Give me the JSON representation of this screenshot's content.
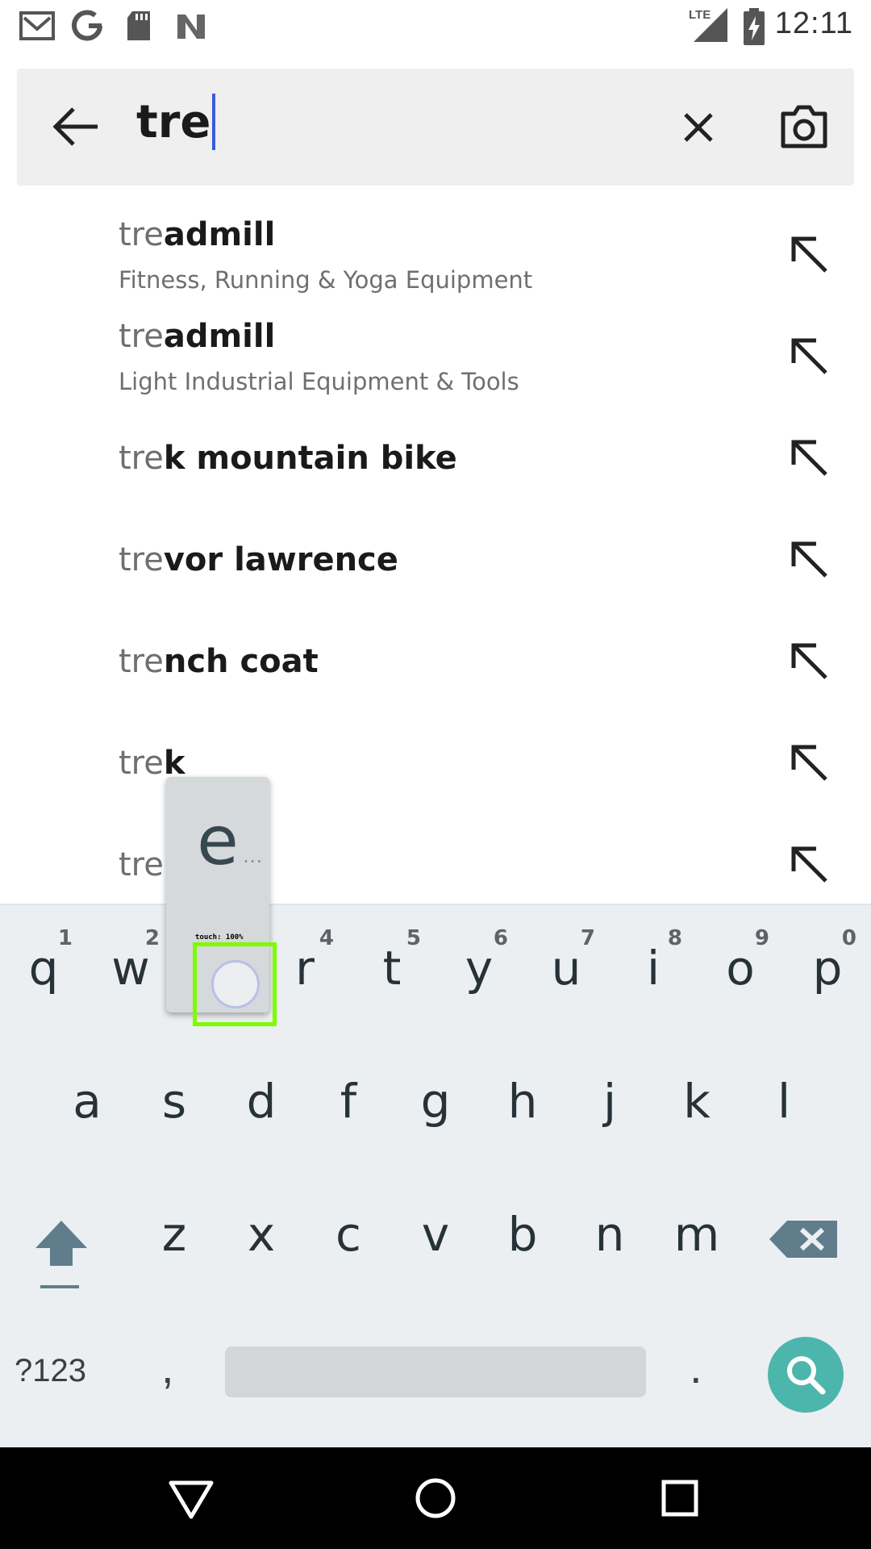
{
  "status_bar": {
    "time": "12:11",
    "left_icons": [
      "gmail-icon",
      "google-icon",
      "sd-card-icon",
      "n-notification-icon"
    ],
    "right_icons": [
      "lte-signal-icon",
      "battery-charging-icon"
    ],
    "network_label": "LTE"
  },
  "search": {
    "query": "tre",
    "back_icon": "arrow-left-icon",
    "clear_icon": "close-icon",
    "camera_icon": "camera-icon"
  },
  "suggestions": [
    {
      "prefix": "tre",
      "rest": "admill",
      "subtitle": "Fitness, Running & Yoga Equipment"
    },
    {
      "prefix": "tre",
      "rest": "admill",
      "subtitle": "Light Industrial Equipment & Tools"
    },
    {
      "prefix": "tre",
      "rest": "k mountain bike",
      "subtitle": ""
    },
    {
      "prefix": "tre",
      "rest": "vor lawrence",
      "subtitle": ""
    },
    {
      "prefix": "tre",
      "rest": "nch coat",
      "subtitle": ""
    },
    {
      "prefix": "tre",
      "rest": "k",
      "subtitle": ""
    },
    {
      "prefix": "tre",
      "rest": "n",
      "subtitle": ""
    }
  ],
  "keyboard": {
    "row1": [
      {
        "key": "q",
        "hint": "1"
      },
      {
        "key": "w",
        "hint": "2"
      },
      {
        "key": "e",
        "hint": "3"
      },
      {
        "key": "r",
        "hint": "4"
      },
      {
        "key": "t",
        "hint": "5"
      },
      {
        "key": "y",
        "hint": "6"
      },
      {
        "key": "u",
        "hint": "7"
      },
      {
        "key": "i",
        "hint": "8"
      },
      {
        "key": "o",
        "hint": "9"
      },
      {
        "key": "p",
        "hint": "0"
      }
    ],
    "row2": [
      "a",
      "s",
      "d",
      "f",
      "g",
      "h",
      "j",
      "k",
      "l"
    ],
    "row3": [
      "z",
      "x",
      "c",
      "v",
      "b",
      "n",
      "m"
    ],
    "symbols_label": "?123",
    "comma_label": ",",
    "period_label": ".",
    "popup_key": "e",
    "popup_more": "...",
    "touch_label": "touch: 100%",
    "accent_color": "#4db6ac"
  },
  "nav_bar": {
    "icons": [
      "back-triangle-icon",
      "home-circle-icon",
      "recents-square-icon"
    ]
  }
}
